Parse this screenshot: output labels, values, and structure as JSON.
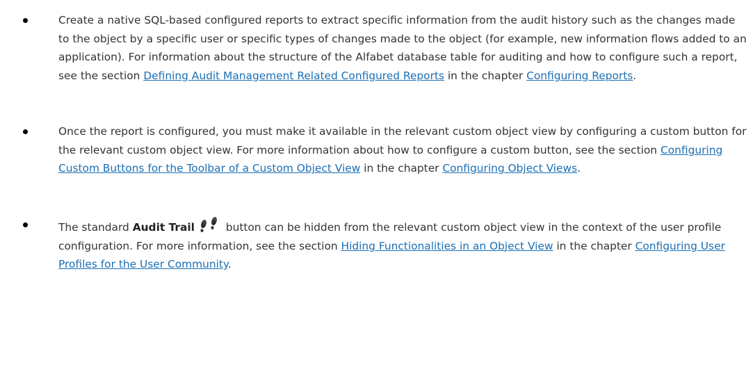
{
  "bullets": [
    {
      "part1": "Create a native SQL-based configured reports to extract specific information from the audit history such as the changes made to the object by a specific user or specific types of changes made to the object (for example, new information flows added to an application). For information about the structure of the Alfabet database table for auditing and how to configure such a report, see the section ",
      "link1": "Defining Audit Management Related Configured Reports",
      "part2": " in the chapter ",
      "link2": "Configuring Reports",
      "part3": "."
    },
    {
      "part1": "Once the report is configured, you must make it available in the relevant custom object view by configuring a custom button for the relevant custom object view. For more information about how to configure a custom button, see the section ",
      "link1": "Configuring Custom Buttons for the Toolbar of a Custom Object View",
      "part2": " in the chapter ",
      "link2": "Configuring Object Views",
      "part3": "."
    },
    {
      "part0": "The standard ",
      "bold": "Audit Trail",
      "icon": "footprints-icon",
      "part1": " button can be hidden from the relevant custom object view in the context of the user profile configuration. For more information, see the section ",
      "link1": "Hiding Functionalities in an Object View",
      "part2": " in the chapter ",
      "link2": "Configuring User Profiles for the User Community",
      "part3": "."
    }
  ],
  "colors": {
    "text": "#333333",
    "link": "#1a6fb5",
    "bullet": "#000000"
  }
}
